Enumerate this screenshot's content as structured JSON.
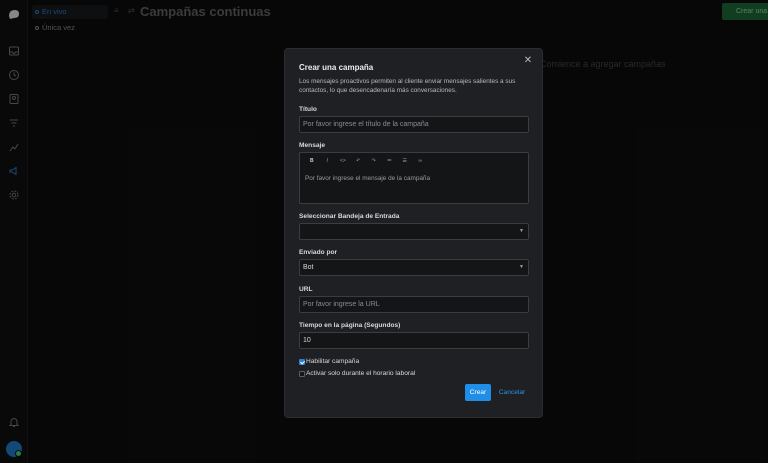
{
  "header": {
    "title": "Campañas continuas",
    "create_label": "Crear una campaña",
    "empty_text": "Comience a agregar campañas"
  },
  "subnav": {
    "items": [
      {
        "label": "En vivo"
      },
      {
        "label": "Única vez"
      }
    ]
  },
  "rail_icons": [
    "inbox-icon",
    "clock-icon",
    "contacts-icon",
    "filter-icon",
    "reports-icon",
    "campaigns-icon",
    "settings-icon",
    "bell-icon"
  ],
  "modal": {
    "title": "Crear una campaña",
    "description": "Los mensajes proactivos permiten al cliente enviar mensajes salientes a sus contactos, lo que desencadenaría más conversaciones.",
    "fields": {
      "title": {
        "label": "Título",
        "placeholder": "Por favor ingrese el título de la campaña"
      },
      "message": {
        "label": "Mensaje",
        "placeholder": "Por favor ingrese el mensaje de la campaña"
      },
      "inbox": {
        "label": "Seleccionar Bandeja de Entrada",
        "value": ""
      },
      "sent_by": {
        "label": "Enviado por",
        "value": "Bot"
      },
      "url": {
        "label": "URL",
        "placeholder": "Por favor ingrese la URL"
      },
      "time_on_page": {
        "label": "Tiempo en la página (Segundos)",
        "value": "10"
      }
    },
    "toolbar": [
      "bold-icon",
      "italic-icon",
      "code-icon",
      "undo-icon",
      "redo-icon",
      "bullet-list-icon",
      "ordered-list-icon",
      "link-icon"
    ],
    "checkboxes": {
      "enable": {
        "label": "Habilitar campaña",
        "checked": true
      },
      "business_hours": {
        "label": "Activar solo durante el horario laboral",
        "checked": false
      }
    },
    "buttons": {
      "create": "Crear",
      "cancel": "Cancelar"
    }
  },
  "colors": {
    "accent": "#1f8ee8",
    "link": "#2d93e6",
    "modal_bg": "#1f2023",
    "page_bg": "#0c0c0d"
  }
}
